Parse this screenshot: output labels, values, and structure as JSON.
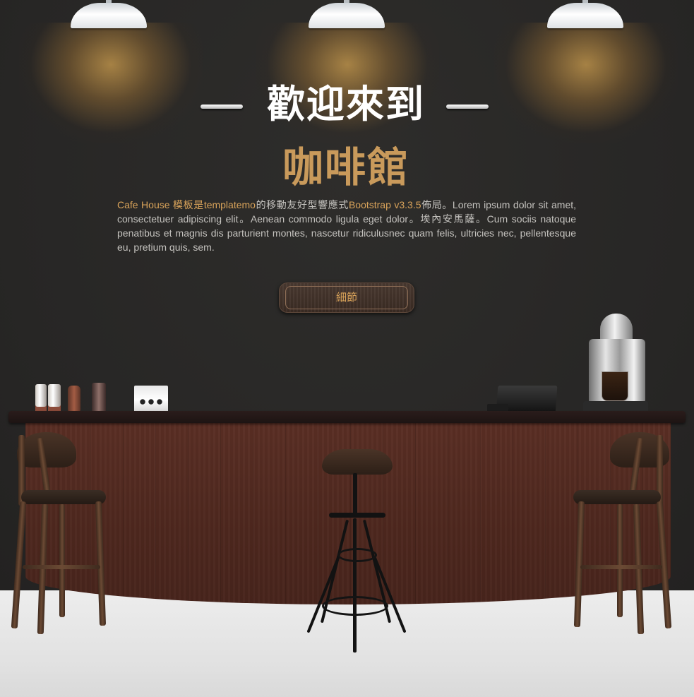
{
  "hero": {
    "welcome": "歡迎來到",
    "cafe_name": "咖啡館",
    "description": {
      "brand": "Cafe House 模板是",
      "templatemo": "templatemo",
      "mid": "的移動友好型響應式",
      "bootstrap": "Bootstrap v3.3.5",
      "rest": "佈局。Lorem ipsum dolor sit amet, consectetuer adipiscing elit。Aenean commodo ligula eget dolor。埃內安馬薩。Cum sociis natoque penatibus et magnis dis parturient montes, nascetur ridiculusnec quam felis, ultricies nec, pellentesque eu, pretium quis, sem."
    },
    "details_button": "細節"
  },
  "colors": {
    "accent": "#c99a5b",
    "highlight": "#d9a35a",
    "wall": "#2a2928",
    "floor": "#e6e6e6",
    "counter": "#4d271e"
  },
  "icons": [
    "pendant-lamp-icon",
    "coffee-machine-icon",
    "cash-register-icon",
    "bar-stool-icon"
  ]
}
